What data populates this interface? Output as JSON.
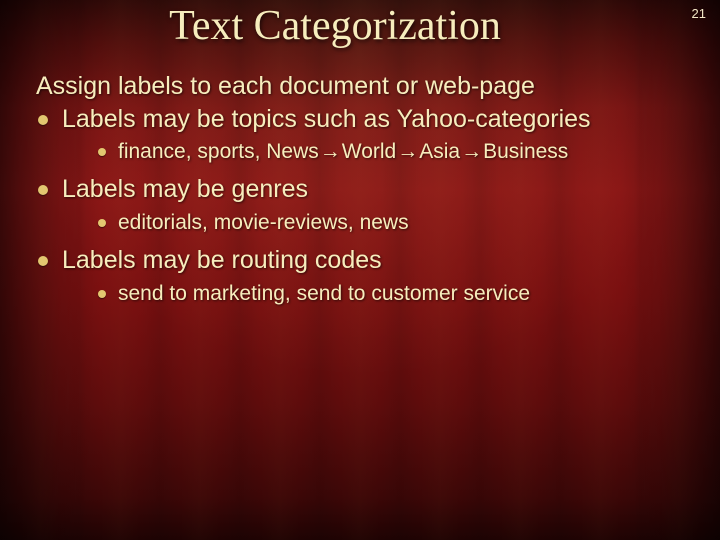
{
  "page_number": "21",
  "title": "Text Categorization",
  "intro": "Assign labels to each document or web-page",
  "items": [
    {
      "label": "Labels may be topics such as Yahoo-categories",
      "sub": {
        "prefix": "finance, sports, News",
        "chain": [
          "World",
          "Asia",
          "Business"
        ]
      }
    },
    {
      "label": "Labels may be genres",
      "sub": {
        "text": "editorials, movie-reviews, news"
      }
    },
    {
      "label": "Labels may be routing codes",
      "sub": {
        "text": "send to marketing, send to customer service"
      }
    }
  ],
  "arrow_glyph": "→"
}
